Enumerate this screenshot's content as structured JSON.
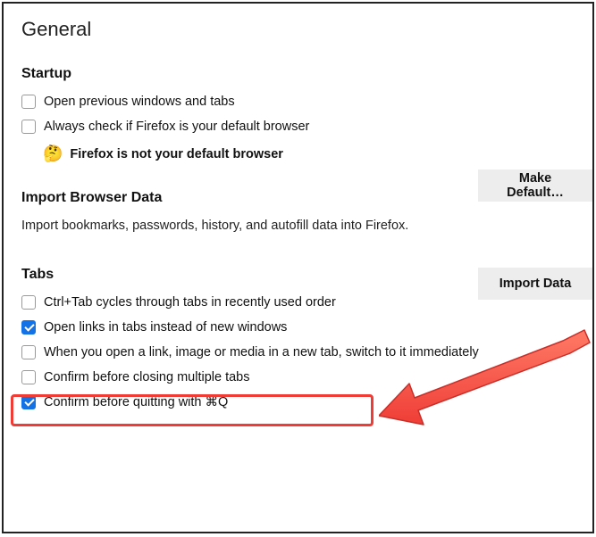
{
  "page": {
    "title": "General"
  },
  "startup": {
    "title": "Startup",
    "open_previous": "Open previous windows and tabs",
    "always_check": "Always check if Firefox is your default browser",
    "status_text": "Firefox is not your default browser",
    "make_default_label": "Make Default…"
  },
  "import": {
    "title": "Import Browser Data",
    "description": "Import bookmarks, passwords, history, and autofill data into Firefox.",
    "button_label": "Import Data"
  },
  "tabs": {
    "title": "Tabs",
    "ctrl_tab": "Ctrl+Tab cycles through tabs in recently used order",
    "open_links": "Open links in tabs instead of new windows",
    "switch_immediately": "When you open a link, image or media in a new tab, switch to it immediately",
    "confirm_close": "Confirm before closing multiple tabs",
    "confirm_quit": "Confirm before quitting with ⌘Q"
  }
}
